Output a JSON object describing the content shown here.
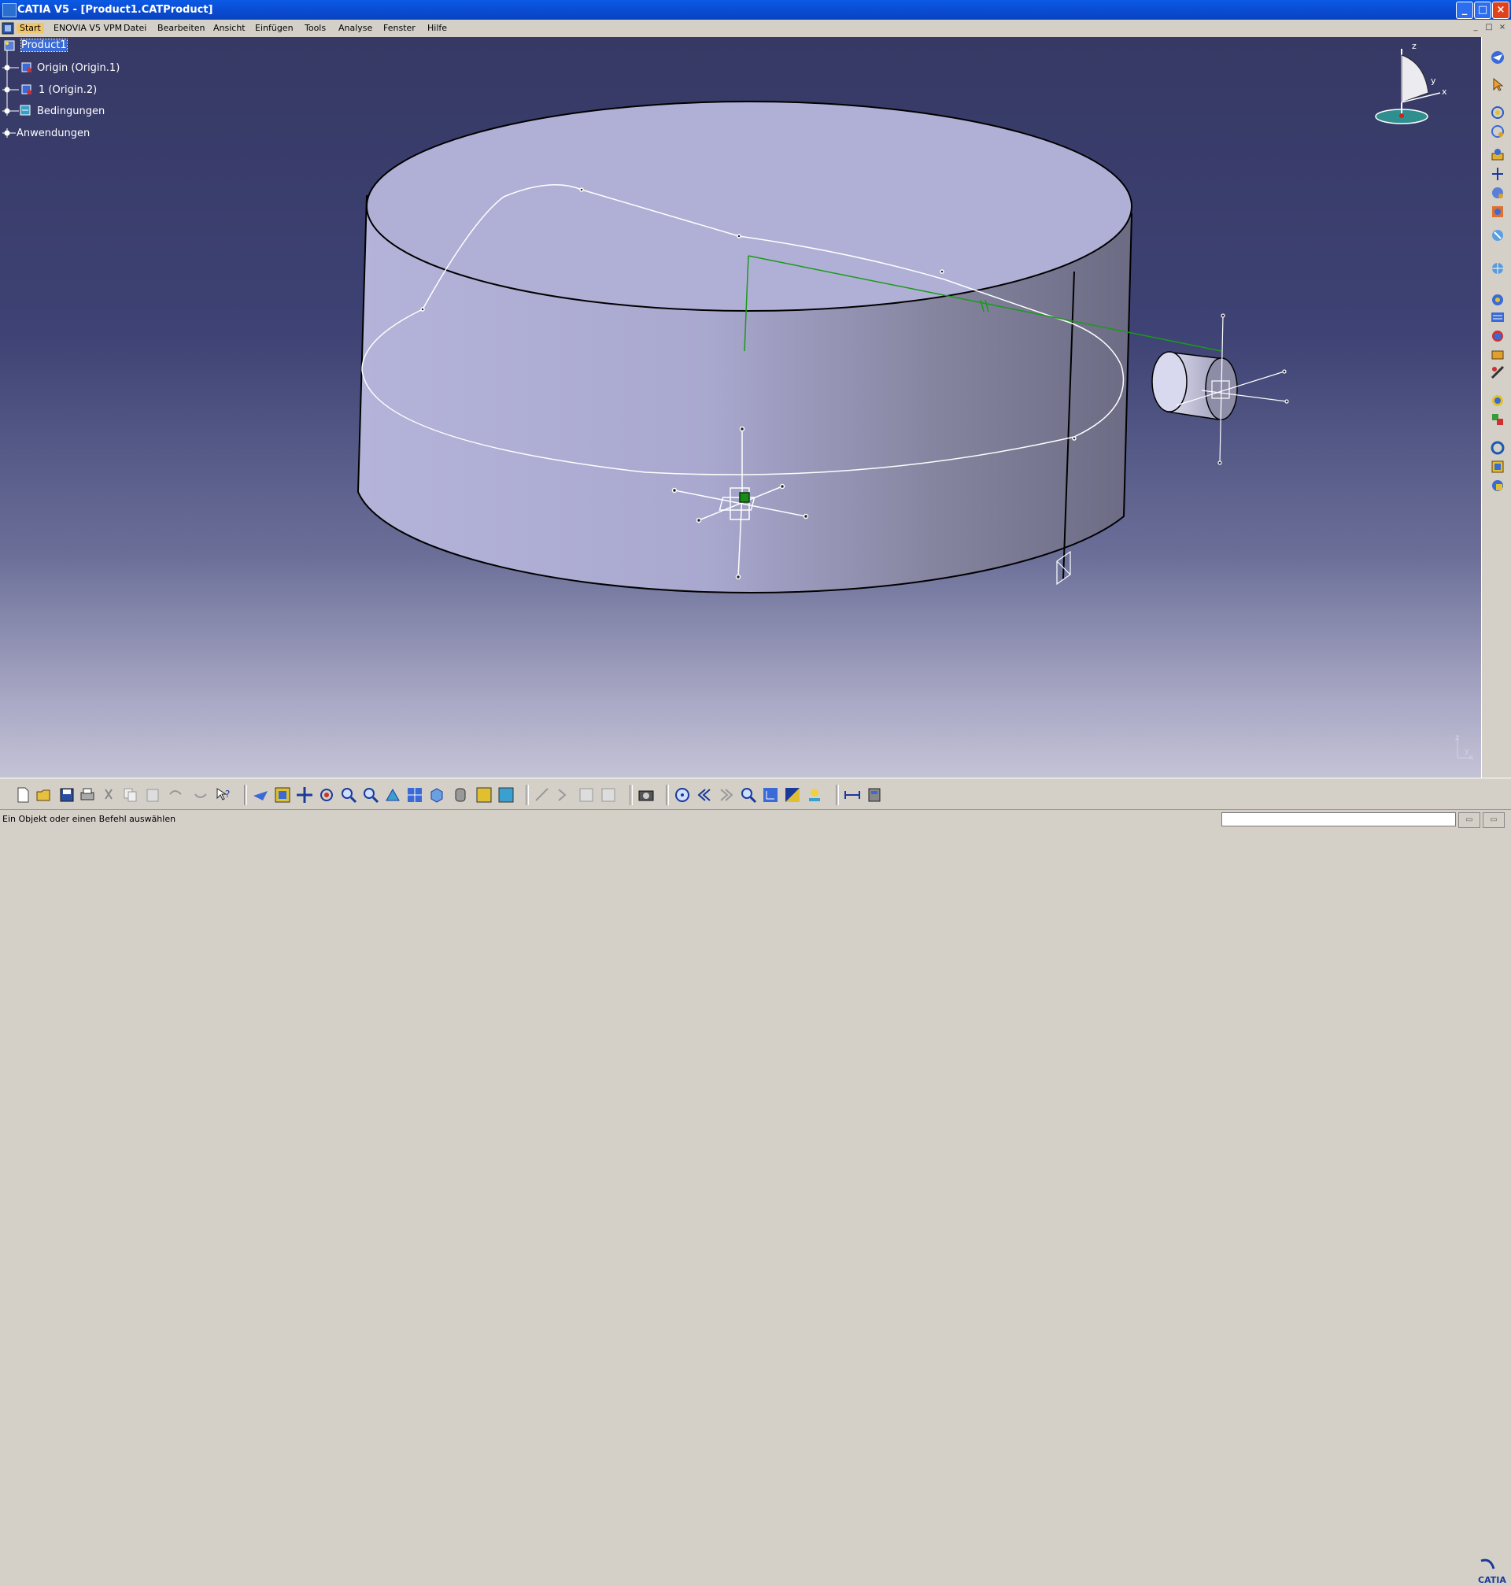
{
  "window": {
    "title": "CATIA V5 - [Product1.CATProduct]",
    "minimize": "_",
    "maximize": "□",
    "close": "×"
  },
  "menubar": {
    "items": [
      "Start",
      "ENOVIA V5 VPM",
      "Datei",
      "Bearbeiten",
      "Ansicht",
      "Einfügen",
      "Tools",
      "Analyse",
      "Fenster",
      "Hilfe"
    ],
    "doc_min": "_",
    "doc_max": "□",
    "doc_close": "×"
  },
  "tree": {
    "root": "Product1",
    "items": [
      "Origin (Origin.1)",
      "1 (Origin.2)",
      "Bedingungen",
      "Anwendungen"
    ]
  },
  "compass": {
    "z": "z",
    "y": "y",
    "x": "x"
  },
  "axes_small": {
    "z": "z",
    "y": "y",
    "x": "x"
  },
  "status": {
    "message": "Ein Objekt oder einen Befehl auswählen",
    "command_value": ""
  },
  "logo": {
    "text": "CATIA"
  },
  "colors": {
    "title_bar": "#0b4fd6",
    "selection": "#3a6ad6",
    "background_top": "#363964",
    "background_bottom": "#c4c3d6",
    "constraint_green": "#1a9a1a"
  },
  "toolbar_right_icons": [
    "fly-mode-icon",
    "select-icon",
    "rotate-icon",
    "manipulation-icon",
    "snap-icon",
    "explode-icon",
    "stop-manipulation-icon",
    "bill-of-material-icon",
    "catalog-browser-icon",
    "move-icon",
    "smart-move-icon",
    "constraint-icon",
    "fix-icon",
    "coincidence-icon",
    "contact-icon",
    "offset-icon",
    "angle-icon",
    "update-icon",
    "scene-icon",
    "clash-icon",
    "sectioning-icon",
    "measure-icon"
  ],
  "toolbar_bottom_icons": [
    "new-icon",
    "open-icon",
    "save-icon",
    "print-icon",
    "cut-icon",
    "copy-icon",
    "paste-icon",
    "undo-icon",
    "redo-icon",
    "whats-this-icon",
    "fly-icon",
    "fit-all-icon",
    "pan-icon",
    "rotate-view-icon",
    "zoom-in-icon",
    "zoom-out-icon",
    "normal-view-icon",
    "multi-view-icon",
    "iso-view-icon",
    "shading-icon",
    "hide-show-icon",
    "swap-visible-icon",
    "sketch-icon",
    "catalog-icon",
    "knowledge-icon",
    "capture-icon",
    "compass-icon",
    "previous-icon",
    "next-icon",
    "search-icon",
    "tree-icon",
    "material-icon",
    "light-icon",
    "measure-between-icon",
    "measure-item-icon"
  ]
}
